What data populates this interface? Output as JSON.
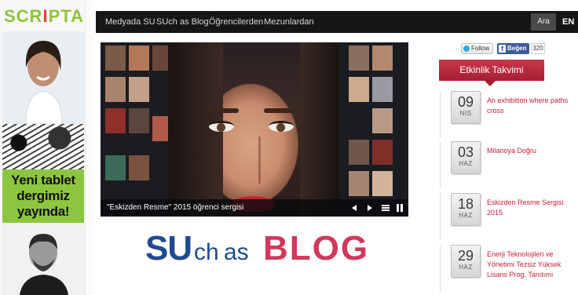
{
  "ad": {
    "logo_part1": "SCR",
    "logo_part2": "I",
    "logo_part3": "PTA",
    "banner_lines": [
      "Yeni tablet",
      "dergimiz",
      "yayında!"
    ]
  },
  "nav": {
    "items": [
      "Medyada SU",
      "SUch as Blog",
      "Öğrencilerden",
      "Mezunlardan"
    ],
    "search_label": "Ara",
    "lang_label": "EN"
  },
  "slider": {
    "caption": "\"Eskizden Resme\" 2015 öğrenci sergisi",
    "controls": [
      "prev-icon",
      "next-icon",
      "list-icon",
      "pause-icon"
    ]
  },
  "blog_logo": {
    "part_su": "SU",
    "part_ch": "ch",
    "part_as": "as",
    "part_blog": "BLOG"
  },
  "social": {
    "twitter_label": "Follow",
    "facebook_label": "Beğen",
    "facebook_count": "320"
  },
  "calendar": {
    "title": "Etkinlik Takvimi",
    "events": [
      {
        "day": "09",
        "month": "NİS",
        "title": "An exhibition where paths cross"
      },
      {
        "day": "03",
        "month": "HAZ",
        "title": "Milanoya Doğru"
      },
      {
        "day": "18",
        "month": "HAZ",
        "title": "Eskizden Resme Sergisi 2015"
      },
      {
        "day": "29",
        "month": "HAZ",
        "title": "Enerji Teknolojileri ve Yönetimi Tezsiz Yüksek Lisans Prog. Tanıtımı"
      }
    ]
  },
  "colors": {
    "nav_bg": "#161616",
    "calendar_red": "#b3263a",
    "event_text": "#c2203b",
    "blog_blue": "#1f4b8f",
    "blog_pink": "#d3375b",
    "ad_green": "#8cc63f"
  }
}
